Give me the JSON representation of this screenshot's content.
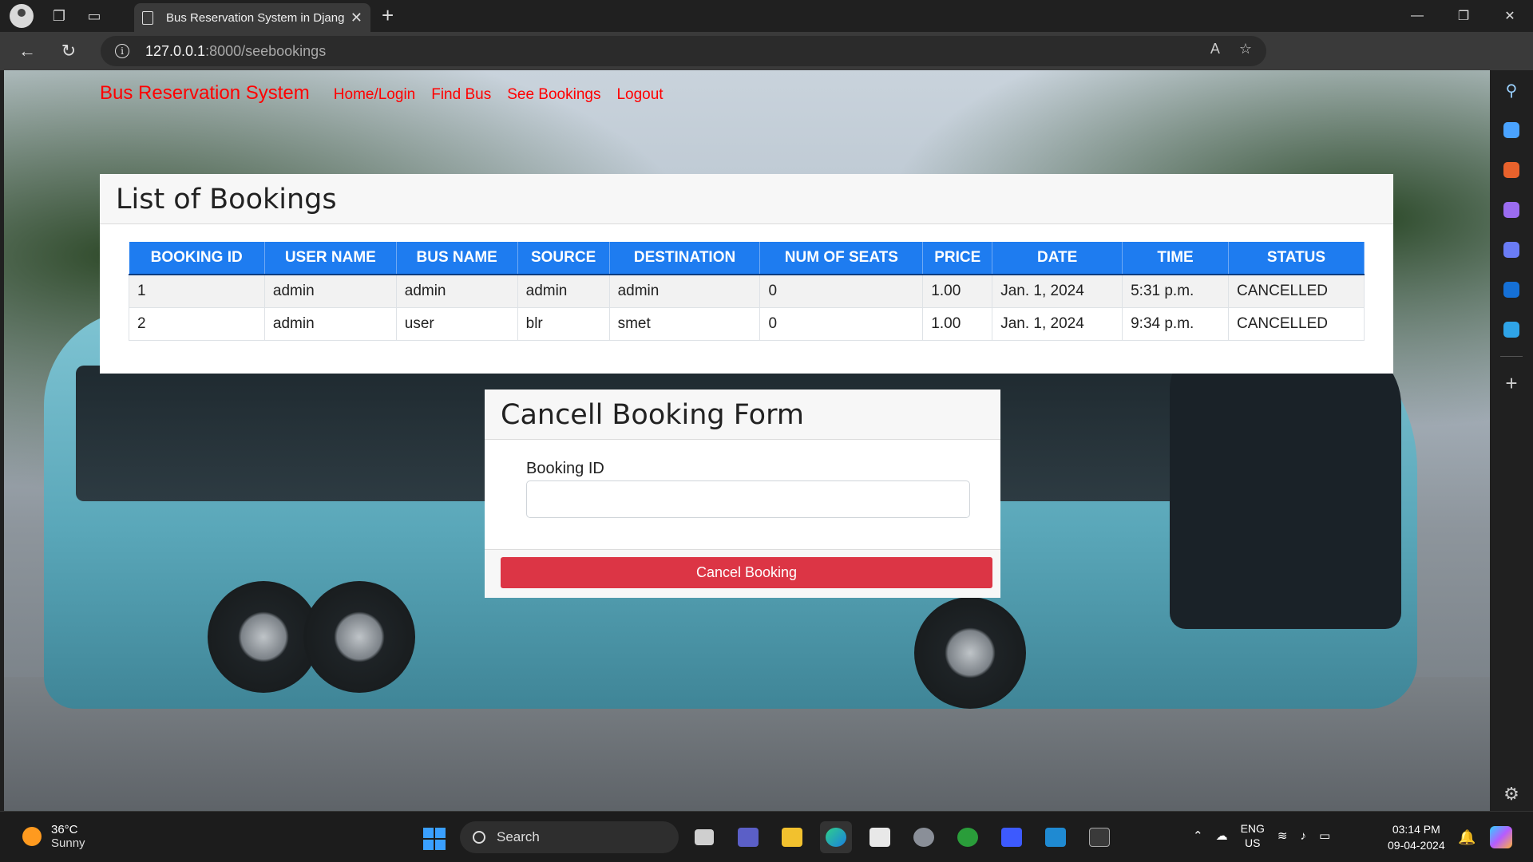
{
  "browser": {
    "tab_title": "Bus Reservation System in Djang",
    "url_host": "127.0.0.1",
    "url_path": ":8000/seebookings"
  },
  "navbar": {
    "brand": "Bus Reservation System",
    "links": [
      "Home/Login",
      "Find Bus",
      "See Bookings",
      "Logout"
    ]
  },
  "bookings": {
    "title": "List of Bookings",
    "headers": [
      "BOOKING ID",
      "USER NAME",
      "BUS NAME",
      "SOURCE",
      "DESTINATION",
      "NUM OF SEATS",
      "PRICE",
      "DATE",
      "TIME",
      "STATUS"
    ],
    "rows": [
      [
        "1",
        "admin",
        "admin",
        "admin",
        "admin",
        "0",
        "1.00",
        "Jan. 1, 2024",
        "5:31 p.m.",
        "CANCELLED"
      ],
      [
        "2",
        "admin",
        "user",
        "blr",
        "smet",
        "0",
        "1.00",
        "Jan. 1, 2024",
        "9:34 p.m.",
        "CANCELLED"
      ]
    ]
  },
  "cancel_form": {
    "title": "Cancell Booking Form",
    "label": "Booking ID",
    "input_value": "",
    "button": "Cancel Booking"
  },
  "taskbar": {
    "temperature": "36°C",
    "weather": "Sunny",
    "search": "Search",
    "lang_top": "ENG",
    "lang_bottom": "US",
    "time": "03:14 PM",
    "date": "09-04-2024"
  },
  "colors": {
    "accent_blue": "#1e7cf0",
    "danger": "#dc3545",
    "nav_red": "#ff0000"
  }
}
